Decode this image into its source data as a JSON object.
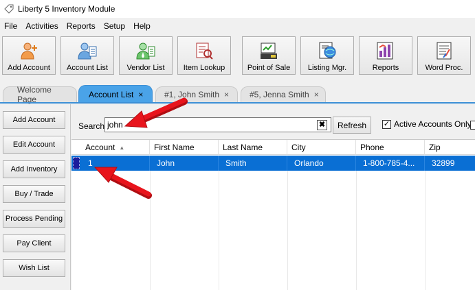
{
  "window": {
    "title": "Liberty 5 Inventory Module"
  },
  "menu": [
    "File",
    "Activities",
    "Reports",
    "Setup",
    "Help"
  ],
  "toolbar": [
    {
      "label": "Add Account",
      "icon": "add-account-icon"
    },
    {
      "label": "Account List",
      "icon": "account-list-icon"
    },
    {
      "label": "Vendor List",
      "icon": "vendor-list-icon"
    },
    {
      "label": "Item Lookup",
      "icon": "item-lookup-icon"
    },
    {
      "label": "Point of Sale",
      "icon": "point-of-sale-icon"
    },
    {
      "label": "Listing Mgr.",
      "icon": "listing-manager-icon"
    },
    {
      "label": "Reports",
      "icon": "reports-icon"
    },
    {
      "label": "Word Proc.",
      "icon": "word-processor-icon"
    }
  ],
  "tabs": [
    {
      "label": "Welcome Page",
      "closable": false,
      "active": false
    },
    {
      "label": "Account List",
      "closable": true,
      "active": true
    },
    {
      "label": "#1, John Smith",
      "closable": true,
      "active": false
    },
    {
      "label": "#5, Jenna Smith",
      "closable": true,
      "active": false
    }
  ],
  "close_glyph": "×",
  "sidebar": [
    "Add Account",
    "Edit Account",
    "Add Inventory",
    "Buy / Trade",
    "Process Pending",
    "Pay Client",
    "Wish List"
  ],
  "search": {
    "label": "Search",
    "value": "john",
    "clear_glyph": "✖"
  },
  "refresh_label": "Refresh",
  "active_only": {
    "label": "Active Accounts Only",
    "checked": true,
    "mark": "✓"
  },
  "table": {
    "columns": [
      "Account",
      "First Name",
      "Last Name",
      "City",
      "Phone",
      "Zip"
    ],
    "sort_indicator": "▲",
    "rows": [
      [
        "1",
        "John",
        "Smith",
        "Orlando",
        "1-800-785-4...",
        "32899"
      ]
    ]
  },
  "colors": {
    "accent": "#4aa3e8",
    "selection": "#0a6fd4",
    "annotation_arrow": "#e8141c"
  }
}
